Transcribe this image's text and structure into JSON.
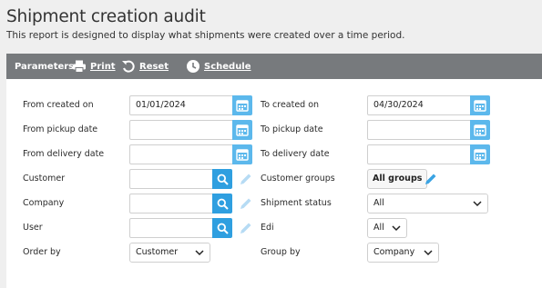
{
  "header": {
    "title": "Shipment creation audit",
    "subtitle": "This report is designed to display what shipments were created over a time period."
  },
  "toolbar": {
    "parameters_label": "Parameters",
    "print_label": "Print",
    "reset_label": "Reset",
    "schedule_label": "Schedule"
  },
  "colors": {
    "toolbar_bg": "#777a7d",
    "calendar_button": "#5cb8ec",
    "search_button": "#2f9fe0",
    "pencil": "#6bbcef"
  },
  "form": {
    "from_created_on": {
      "label": "From created on",
      "value": "01/01/2024"
    },
    "to_created_on": {
      "label": "To created on",
      "value": "04/30/2024"
    },
    "from_pickup_date": {
      "label": "From pickup date",
      "value": ""
    },
    "to_pickup_date": {
      "label": "To pickup date",
      "value": ""
    },
    "from_delivery_date": {
      "label": "From delivery date",
      "value": ""
    },
    "to_delivery_date": {
      "label": "To delivery date",
      "value": ""
    },
    "customer": {
      "label": "Customer",
      "value": ""
    },
    "customer_groups": {
      "label": "Customer groups",
      "button": "All groups"
    },
    "company": {
      "label": "Company",
      "value": ""
    },
    "shipment_status": {
      "label": "Shipment status",
      "selected": "All"
    },
    "user": {
      "label": "User",
      "value": ""
    },
    "edi": {
      "label": "Edi",
      "selected": "All"
    },
    "order_by": {
      "label": "Order by",
      "selected": "Customer"
    },
    "group_by": {
      "label": "Group by",
      "selected": "Company"
    }
  }
}
